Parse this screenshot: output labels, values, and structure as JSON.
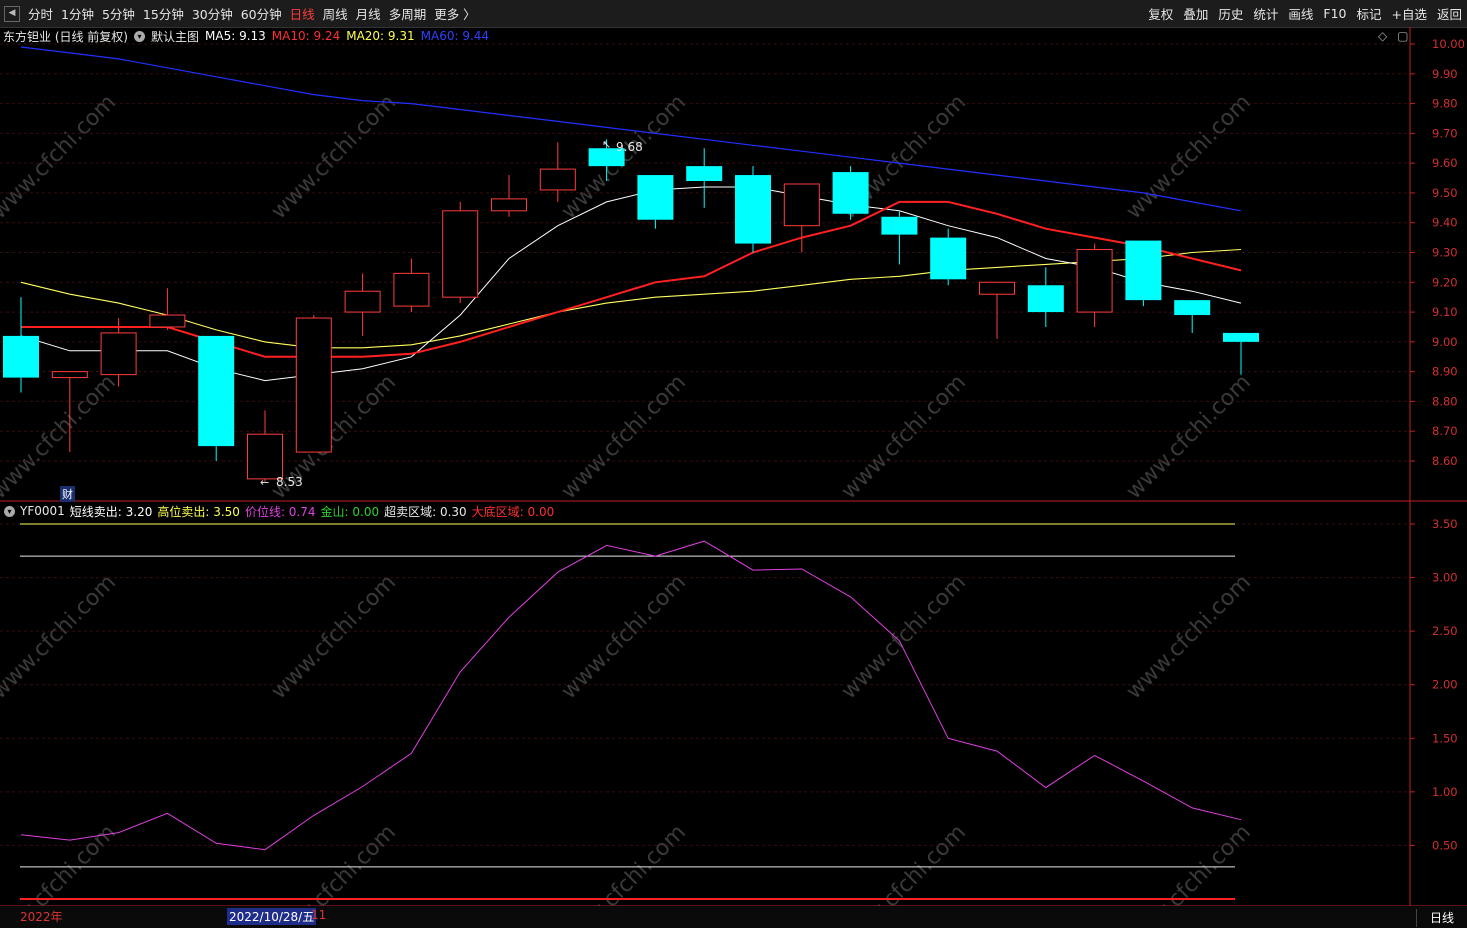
{
  "toolbar": {
    "left_items": [
      "分时",
      "1分钟",
      "5分钟",
      "15分钟",
      "30分钟",
      "60分钟",
      "日线",
      "周线",
      "月线",
      "多周期",
      "更多 〉"
    ],
    "active_item": "日线",
    "right_items": [
      "复权",
      "叠加",
      "历史",
      "统计",
      "画线",
      "F10",
      "标记",
      "+自选",
      "返回"
    ]
  },
  "main_header": {
    "stock": "东方钽业 (日线 前复权)",
    "template": "默认主图",
    "ma5": "MA5: 9.13",
    "ma10": "MA10: 9.24",
    "ma20": "MA20: 9.31",
    "ma60": "MA60: 9.44"
  },
  "sub_header": {
    "name": "YF0001",
    "short_sell": "短线卖出: 3.20",
    "high_sell": "高位卖出: 3.50",
    "price_line": "价位线: 0.74",
    "golden": "金山: 0.00",
    "oversold": "超卖区域: 0.30",
    "bottom": "大底区域: 0.00"
  },
  "annotations": {
    "high": "9.68",
    "low": "8.53",
    "cai": "财"
  },
  "bottom": {
    "year": "2022年",
    "cursor_date": "2022/10/28/五",
    "month": "11",
    "period": "日线"
  },
  "colors": {
    "up": "#ff3c3c",
    "down": "#00ffff",
    "ma5": "#ffffff",
    "ma10": "#ff2020",
    "ma20": "#ffff60",
    "ma60": "#2030ff",
    "price_line": "#e040e0",
    "axis": "#c02020"
  },
  "chart_data": [
    {
      "type": "candlestick",
      "ylim": [
        8.45,
        10.05
      ],
      "y_ticks": [
        "10.00",
        "9.90",
        "9.80",
        "9.70",
        "9.60",
        "9.50",
        "9.40",
        "9.30",
        "9.20",
        "9.10",
        "9.00",
        "8.90",
        "8.80",
        "8.70",
        "8.60"
      ],
      "candles": [
        {
          "o": 9.02,
          "c": 8.88,
          "h": 9.15,
          "l": 8.83
        },
        {
          "o": 8.88,
          "c": 8.9,
          "h": 8.9,
          "l": 8.63
        },
        {
          "o": 8.89,
          "c": 9.03,
          "h": 9.08,
          "l": 8.85
        },
        {
          "o": 9.05,
          "c": 9.09,
          "h": 9.18,
          "l": 9.04
        },
        {
          "o": 9.02,
          "c": 8.65,
          "h": 9.02,
          "l": 8.6
        },
        {
          "o": 8.54,
          "c": 8.69,
          "h": 8.77,
          "l": 8.53
        },
        {
          "o": 8.63,
          "c": 9.08,
          "h": 9.09,
          "l": 8.63
        },
        {
          "o": 9.1,
          "c": 9.17,
          "h": 9.23,
          "l": 9.02
        },
        {
          "o": 9.12,
          "c": 9.23,
          "h": 9.28,
          "l": 9.1
        },
        {
          "o": 9.15,
          "c": 9.44,
          "h": 9.47,
          "l": 9.13
        },
        {
          "o": 9.44,
          "c": 9.48,
          "h": 9.56,
          "l": 9.42
        },
        {
          "o": 9.51,
          "c": 9.58,
          "h": 9.67,
          "l": 9.47
        },
        {
          "o": 9.65,
          "c": 9.59,
          "h": 9.68,
          "l": 9.54
        },
        {
          "o": 9.56,
          "c": 9.41,
          "h": 9.56,
          "l": 9.38
        },
        {
          "o": 9.59,
          "c": 9.54,
          "h": 9.65,
          "l": 9.45
        },
        {
          "o": 9.56,
          "c": 9.33,
          "h": 9.59,
          "l": 9.3
        },
        {
          "o": 9.39,
          "c": 9.53,
          "h": 9.53,
          "l": 9.3
        },
        {
          "o": 9.57,
          "c": 9.43,
          "h": 9.59,
          "l": 9.41
        },
        {
          "o": 9.42,
          "c": 9.36,
          "h": 9.44,
          "l": 9.26
        },
        {
          "o": 9.35,
          "c": 9.21,
          "h": 9.38,
          "l": 9.19
        },
        {
          "o": 9.16,
          "c": 9.2,
          "h": 9.2,
          "l": 9.01
        },
        {
          "o": 9.19,
          "c": 9.1,
          "h": 9.25,
          "l": 9.05
        },
        {
          "o": 9.1,
          "c": 9.31,
          "h": 9.33,
          "l": 9.05
        },
        {
          "o": 9.34,
          "c": 9.14,
          "h": 9.34,
          "l": 9.12
        },
        {
          "o": 9.14,
          "c": 9.09,
          "h": 9.14,
          "l": 9.03
        },
        {
          "o": 9.03,
          "c": 9.0,
          "h": 9.03,
          "l": 8.89
        }
      ],
      "ma5": [
        9.02,
        8.97,
        8.97,
        8.97,
        8.91,
        8.87,
        8.89,
        8.91,
        8.95,
        9.09,
        9.28,
        9.39,
        9.47,
        9.51,
        9.52,
        9.52,
        9.49,
        9.46,
        9.44,
        9.39,
        9.35,
        9.28,
        9.25,
        9.2,
        9.17,
        9.13
      ],
      "ma10": [
        9.05,
        9.05,
        9.05,
        9.05,
        9.0,
        8.95,
        8.95,
        8.95,
        8.96,
        9.0,
        9.05,
        9.1,
        9.15,
        9.2,
        9.22,
        9.3,
        9.35,
        9.39,
        9.47,
        9.47,
        9.43,
        9.38,
        9.35,
        9.32,
        9.28,
        9.24
      ],
      "ma20": [
        9.2,
        9.16,
        9.13,
        9.09,
        9.04,
        9.0,
        8.98,
        8.98,
        8.99,
        9.02,
        9.06,
        9.1,
        9.13,
        9.15,
        9.16,
        9.17,
        9.19,
        9.21,
        9.22,
        9.24,
        9.25,
        9.26,
        9.27,
        9.28,
        9.3,
        9.31
      ],
      "ma60": [
        9.99,
        9.97,
        9.95,
        9.92,
        9.89,
        9.86,
        9.83,
        9.81,
        9.8,
        9.78,
        9.76,
        9.74,
        9.72,
        9.7,
        9.68,
        9.66,
        9.64,
        9.62,
        9.6,
        9.58,
        9.56,
        9.54,
        9.52,
        9.5,
        9.47,
        9.44
      ]
    },
    {
      "type": "line",
      "ylim": [
        0.0,
        3.6
      ],
      "y_ticks": [
        "3.50",
        "3.00",
        "2.50",
        "2.00",
        "1.50",
        "1.00",
        "0.50"
      ],
      "series": [
        {
          "name": "价位线",
          "values": [
            0.6,
            0.55,
            0.62,
            0.8,
            0.52,
            0.46,
            0.78,
            1.05,
            1.36,
            2.12,
            2.63,
            3.05,
            3.3,
            3.2,
            3.34,
            3.07,
            3.08,
            2.82,
            2.41,
            1.5,
            1.38,
            1.04,
            1.34,
            1.1,
            0.85,
            0.74
          ]
        }
      ],
      "levels": [
        {
          "name": "高位卖出",
          "value": 3.5
        },
        {
          "name": "短线卖出",
          "value": 3.2
        },
        {
          "name": "超卖区域",
          "value": 0.3
        },
        {
          "name": "大底区域",
          "value": 0.0
        }
      ]
    }
  ]
}
